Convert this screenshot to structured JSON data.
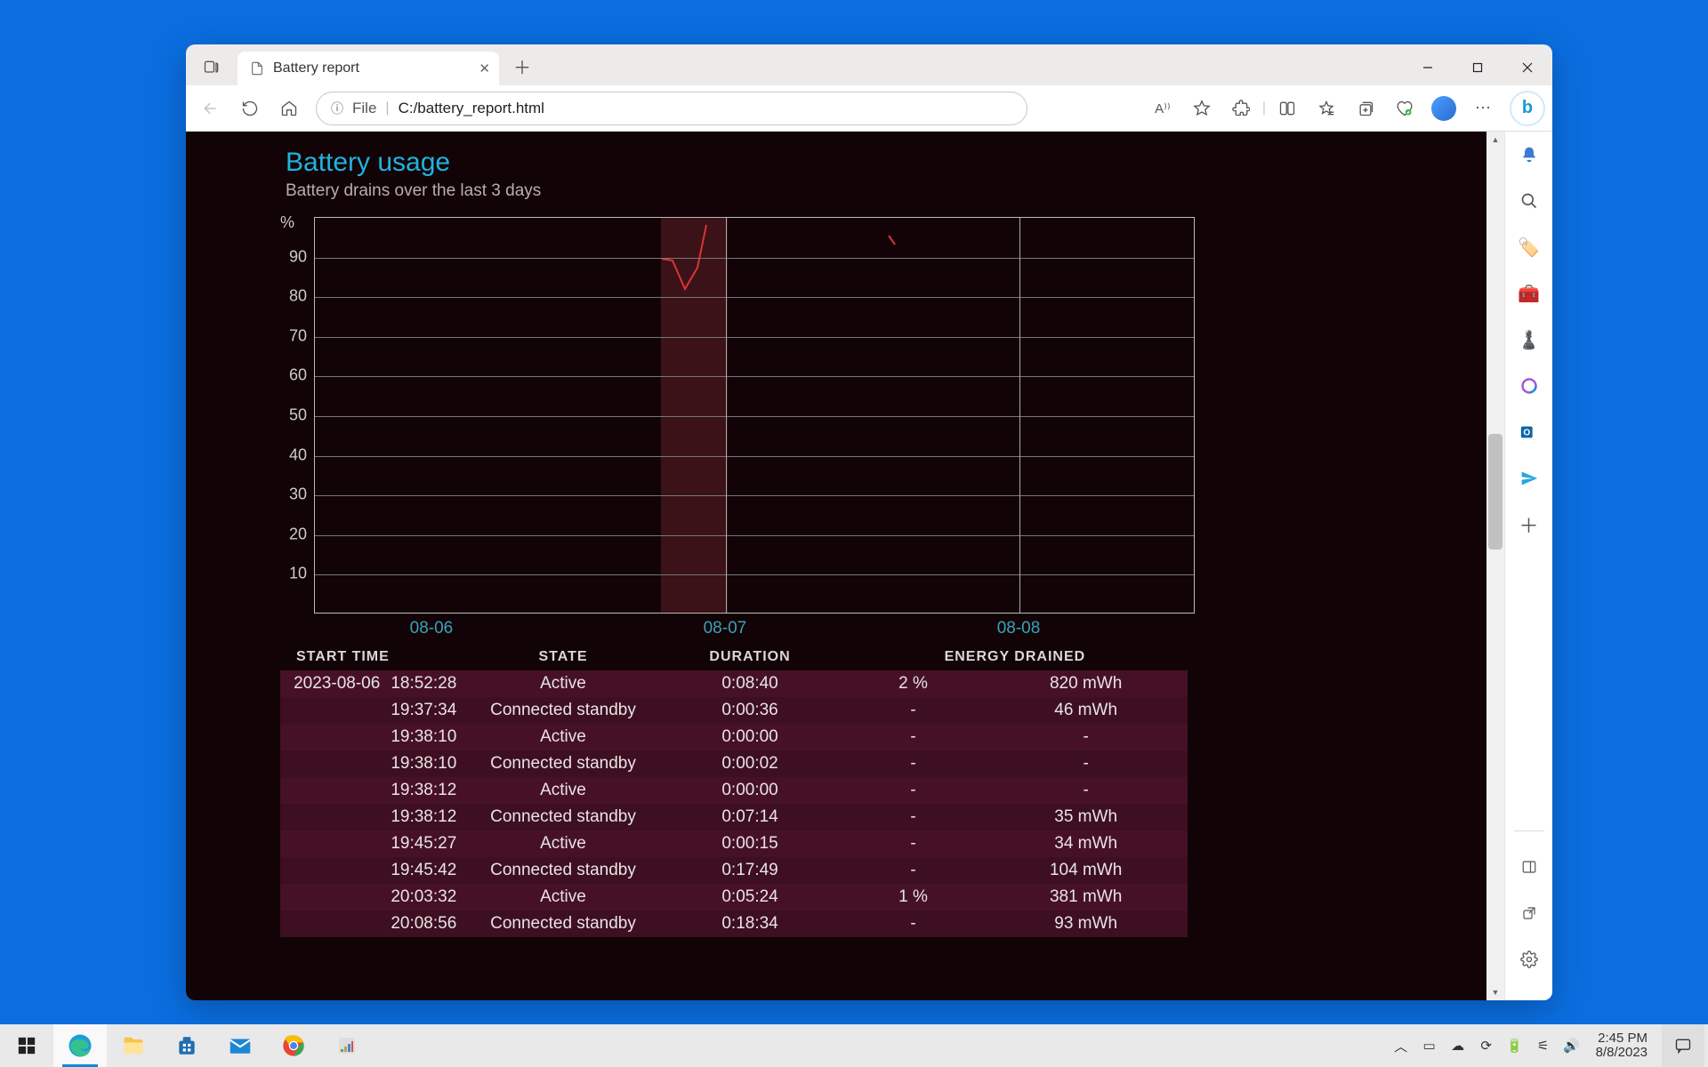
{
  "browser": {
    "tab_title": "Battery report",
    "addr_label": "File",
    "addr_path": "C:/battery_report.html"
  },
  "report": {
    "title": "Battery usage",
    "subtitle": "Battery drains over the last 3 days",
    "headers": [
      "START TIME",
      "STATE",
      "DURATION",
      "ENERGY DRAINED"
    ],
    "rows": [
      {
        "date": "2023-08-06",
        "time": "18:52:28",
        "state": "Active",
        "duration": "0:08:40",
        "pct": "2 %",
        "energy": "820 mWh"
      },
      {
        "date": "",
        "time": "19:37:34",
        "state": "Connected standby",
        "duration": "0:00:36",
        "pct": "-",
        "energy": "46 mWh"
      },
      {
        "date": "",
        "time": "19:38:10",
        "state": "Active",
        "duration": "0:00:00",
        "pct": "-",
        "energy": "-"
      },
      {
        "date": "",
        "time": "19:38:10",
        "state": "Connected standby",
        "duration": "0:00:02",
        "pct": "-",
        "energy": "-"
      },
      {
        "date": "",
        "time": "19:38:12",
        "state": "Active",
        "duration": "0:00:00",
        "pct": "-",
        "energy": "-"
      },
      {
        "date": "",
        "time": "19:38:12",
        "state": "Connected standby",
        "duration": "0:07:14",
        "pct": "-",
        "energy": "35 mWh"
      },
      {
        "date": "",
        "time": "19:45:27",
        "state": "Active",
        "duration": "0:00:15",
        "pct": "-",
        "energy": "34 mWh"
      },
      {
        "date": "",
        "time": "19:45:42",
        "state": "Connected standby",
        "duration": "0:17:49",
        "pct": "-",
        "energy": "104 mWh"
      },
      {
        "date": "",
        "time": "20:03:32",
        "state": "Active",
        "duration": "0:05:24",
        "pct": "1 %",
        "energy": "381 mWh"
      },
      {
        "date": "",
        "time": "20:08:56",
        "state": "Connected standby",
        "duration": "0:18:34",
        "pct": "-",
        "energy": "93 mWh"
      }
    ]
  },
  "chart_data": {
    "type": "line",
    "title": "Battery usage",
    "xlabel": "",
    "ylabel": "%",
    "ylim": [
      0,
      100
    ],
    "y_ticks": [
      10,
      20,
      30,
      40,
      50,
      60,
      70,
      80,
      90
    ],
    "x_ticks": [
      "08-06",
      "08-07",
      "08-08"
    ],
    "series": [
      {
        "name": "battery-percent",
        "points": [
          {
            "x": "2023-08-06 18:52",
            "y": 90
          },
          {
            "x": "2023-08-06 20:30",
            "y": 82
          },
          {
            "x": "2023-08-06 23:00",
            "y": 99
          },
          {
            "x": "2023-08-07 13:40",
            "y": 96
          },
          {
            "x": "2023-08-07 14:00",
            "y": 94
          }
        ]
      }
    ],
    "active_bands": [
      "2023-08-06 18:52 – 2023-08-06 23:40"
    ]
  },
  "tray": {
    "time": "2:45 PM",
    "date": "8/8/2023"
  }
}
